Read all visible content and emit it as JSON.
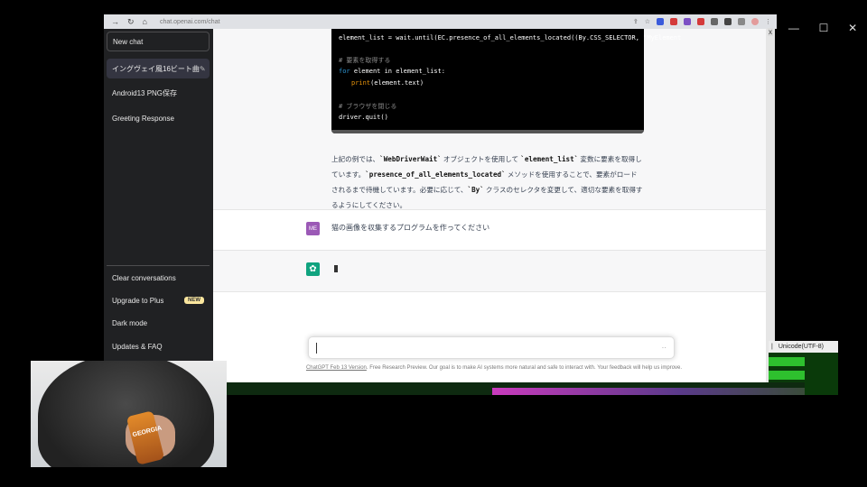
{
  "browser": {
    "url": "chat.openai.com/chat"
  },
  "sidebar": {
    "new_chat": "New chat",
    "items": [
      {
        "label": "イングヴェイ風16ビート曲",
        "active": true
      },
      {
        "label": "Android13 PNG保存",
        "active": false
      },
      {
        "label": "Greeting Response",
        "active": false
      }
    ],
    "bottom": {
      "clear": "Clear conversations",
      "upgrade": "Upgrade to Plus",
      "new_badge": "NEW",
      "dark": "Dark mode",
      "faq": "Updates & FAQ"
    }
  },
  "code": {
    "line1": "element_list = wait.until(EC.presence_of_all_elements_located((By.CSS_SELECTOR, \"MyElement",
    "comment1": "# 要素を取得する",
    "line3_kw": "for",
    "line3_rest": " element in element_list:",
    "line4_fn": "print",
    "line4_rest": "(element.text)",
    "comment2": "# ブラウザを閉じる",
    "line6": "driver.quit()"
  },
  "answer": {
    "p1": "上記の例では、",
    "c1": "`WebDriverWait`",
    "p2": " オブジェクトを使用して ",
    "c2": "`element_list`",
    "p3": " 変数に要素を取得しています。",
    "c3": "`presence_of_all_elements_located`",
    "p4": " メソッドを使用することで、要素がロードされるまで待機しています。必要に応じて、",
    "c4": "`By`",
    "p5": " クラスのセレクタを変更して、適切な要素を取得するようにしてください。"
  },
  "user": {
    "avatar": "ME",
    "message": "猫の画像を収集するプログラムを作ってください"
  },
  "input": {
    "send_glyph": "··"
  },
  "footer": {
    "link": "ChatGPT Feb 13 Version",
    "text": ". Free Research Preview. Our goal is to make AI systems more natural and safe to interact with. Your feedback will help us improve."
  },
  "right": {
    "label": "x",
    "encoding": "Unicode(UTF-8)"
  },
  "webcam": {
    "bottle_text": "GEORGIA"
  },
  "colors": {
    "sidebar_bg": "#202123",
    "gpt_green": "#10a37f",
    "user_avatar": "#9b59b6"
  }
}
